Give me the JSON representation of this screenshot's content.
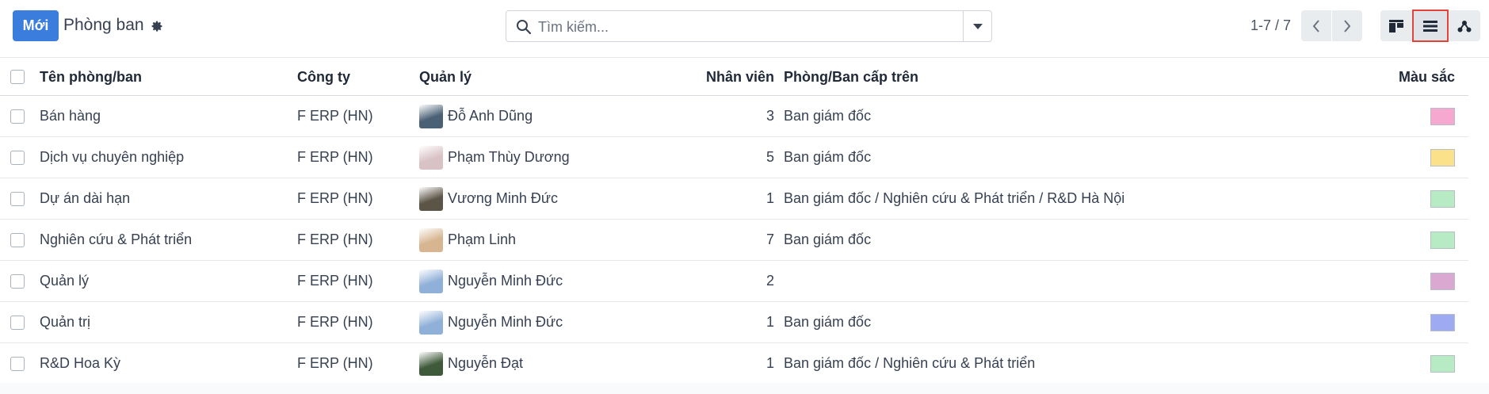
{
  "control_panel": {
    "new_button": "Mới",
    "breadcrumb_title": "Phòng ban",
    "search_placeholder": "Tìm kiếm...",
    "pager_value": "1-7 / 7",
    "active_view": "list"
  },
  "table": {
    "headers": {
      "name": "Tên phòng/ban",
      "company": "Công ty",
      "manager": "Quản lý",
      "employees": "Nhân viên",
      "parent": "Phòng/Ban cấp trên",
      "color": "Màu sắc"
    },
    "rows": [
      {
        "name": "Bán hàng",
        "company": "F ERP (HN)",
        "manager": "Đỗ Anh Dũng",
        "employees": "3",
        "parent": "Ban giám đốc",
        "color": "#f7a8d0",
        "avatar_color": "#4a6075"
      },
      {
        "name": "Dịch vụ chuyên nghiệp",
        "company": "F ERP (HN)",
        "manager": "Phạm Thùy Dương",
        "employees": "5",
        "parent": "Ban giám đốc",
        "color": "#fbe18a",
        "avatar_color": "#d9c2c6"
      },
      {
        "name": "Dự án dài hạn",
        "company": "F ERP (HN)",
        "manager": "Vương Minh Đức",
        "employees": "1",
        "parent": "Ban giám đốc / Nghiên cứu & Phát triển / R&D Hà Nội",
        "color": "#b7ebc4",
        "avatar_color": "#5c5446"
      },
      {
        "name": "Nghiên cứu & Phát triển",
        "company": "F ERP (HN)",
        "manager": "Phạm Linh",
        "employees": "7",
        "parent": "Ban giám đốc",
        "color": "#b7ebc4",
        "avatar_color": "#d6b590"
      },
      {
        "name": "Quản lý",
        "company": "F ERP (HN)",
        "manager": "Nguyễn Minh Đức",
        "employees": "2",
        "parent": "",
        "color": "#dba8d1",
        "avatar_color": "#8fb0d8"
      },
      {
        "name": "Quản trị",
        "company": "F ERP (HN)",
        "manager": "Nguyễn Minh Đức",
        "employees": "1",
        "parent": "Ban giám đốc",
        "color": "#9eaaf2",
        "avatar_color": "#8fb0d8"
      },
      {
        "name": "R&D Hoa Kỳ",
        "company": "F ERP (HN)",
        "manager": "Nguyễn Đạt",
        "employees": "1",
        "parent": "Ban giám đốc / Nghiên cứu & Phát triển",
        "color": "#b7ebc4",
        "avatar_color": "#3f5a3a"
      }
    ]
  },
  "colors": {
    "primary": "#3b7ddd",
    "active_view_outline": "#e0453a"
  }
}
